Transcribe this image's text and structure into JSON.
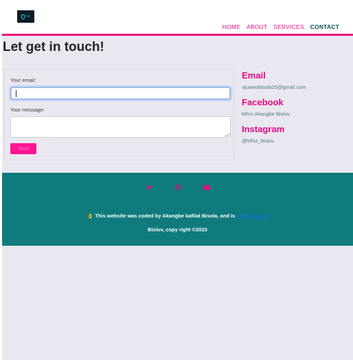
{
  "colors": {
    "accent": "#e8087f",
    "footer_bg": "#0f7b7d",
    "page_bg": "#e9e7ef",
    "nav_active": "#0f4f55"
  },
  "header": {
    "logo_text": "ℓℓℓ",
    "nav": [
      {
        "label": "HOME",
        "active": false
      },
      {
        "label": "ABOUT",
        "active": false
      },
      {
        "label": "SERVICES",
        "active": false
      },
      {
        "label": "CONTACT",
        "active": true
      }
    ]
  },
  "main": {
    "title": "Let get in touch!",
    "form": {
      "email_label": "Your email:",
      "email_value": "",
      "message_label": "Your message:",
      "message_value": "",
      "send_label": "Send"
    },
    "contact": {
      "email_heading": "Email",
      "email_value": "ojuawobisola25@gmail.com",
      "facebook_heading": "Facebook",
      "facebook_value": "Mhrz Akangbe Bisluv",
      "instagram_heading": "Instagram",
      "instagram_value": "@Mhiz_bisluv"
    }
  },
  "footer": {
    "social_icons": [
      "twitter-icon",
      "instagram-icon",
      "youtube-icon"
    ],
    "credit_prefix": "👌",
    "credit_text": "This website was coded by Akangbe kafilat Bisola, and is",
    "credit_link": "open-sourced",
    "copyright": "Bisluv, copy right ©2023"
  }
}
